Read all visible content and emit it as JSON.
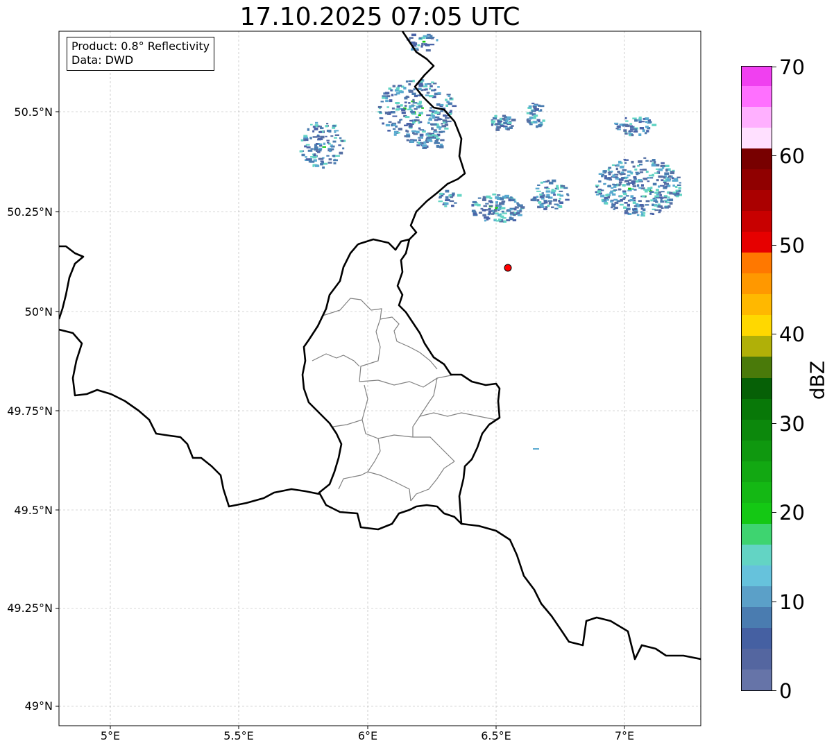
{
  "title": "17.10.2025 07:05 UTC",
  "info": {
    "product": "Product: 0.8° Reflectivity",
    "source": "Data: DWD"
  },
  "lat_ticks": [
    "49°N",
    "49.25°N",
    "49.5°N",
    "49.75°N",
    "50°N",
    "50.25°N",
    "50.5°N"
  ],
  "lon_ticks": [
    "5°E",
    "5.5°E",
    "6°E",
    "6.5°E",
    "7°E"
  ],
  "map_extent": {
    "lon": [
      4.8,
      7.3
    ],
    "lat": [
      48.95,
      50.69
    ]
  },
  "radar_site": {
    "lon": 6.55,
    "lat": 50.11,
    "color": "#ff0000"
  },
  "colorbar": {
    "unit": "dBZ",
    "ticks": [
      "0",
      "10",
      "20",
      "30",
      "40",
      "50",
      "60",
      "70"
    ],
    "range": [
      0,
      70
    ],
    "colors": [
      "#6674a8",
      "#5466a0",
      "#4560a2",
      "#4a7cb0",
      "#5ba0c8",
      "#66c2dc",
      "#63d4c4",
      "#3ed470",
      "#14c814",
      "#14b814",
      "#12a812",
      "#0f980f",
      "#0c880c",
      "#087808",
      "#066006",
      "#4a7a0a",
      "#b0b008",
      "#ffd800",
      "#ffb800",
      "#ff9800",
      "#ff7800",
      "#e60000",
      "#c80000",
      "#aa0000",
      "#900000",
      "#780000",
      "#ffe0ff",
      "#ffb0ff",
      "#ff70ff",
      "#f040f0"
    ]
  },
  "colors": {
    "border": "#000000",
    "admin": "#808080",
    "grid": "#b0b0b0",
    "echo_low": "#4a64a8",
    "echo_mid": "#5aaad0",
    "echo_high": "#14c814"
  }
}
